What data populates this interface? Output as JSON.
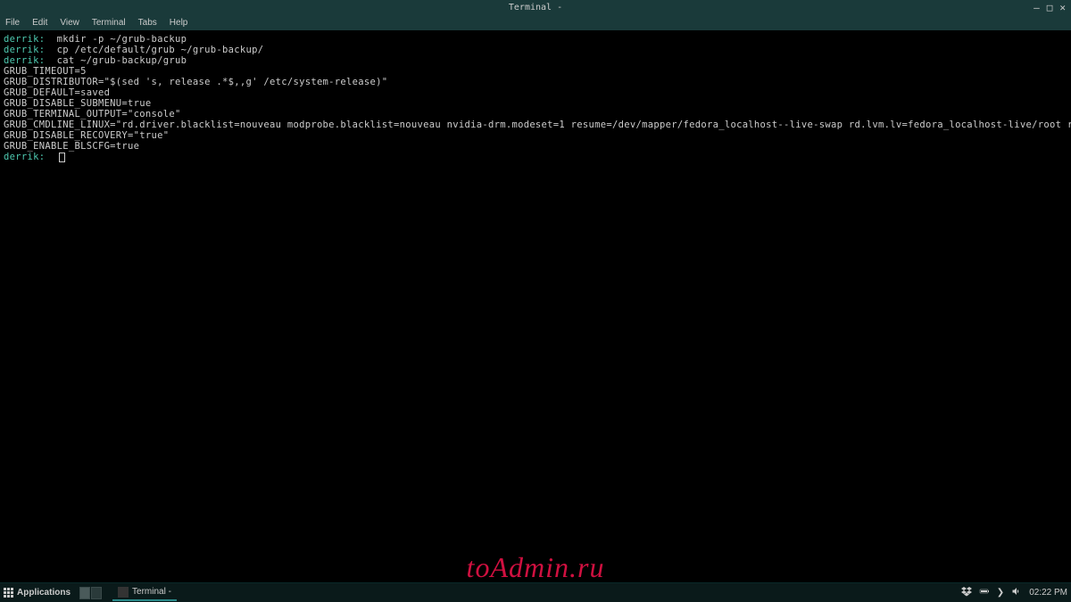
{
  "window": {
    "title": "Terminal -"
  },
  "menubar": {
    "items": [
      "File",
      "Edit",
      "View",
      "Terminal",
      "Tabs",
      "Help"
    ]
  },
  "terminal": {
    "lines": [
      {
        "prompt": "derrik:",
        "cmd": "  mkdir -p ~/grub-backup"
      },
      {
        "prompt": "derrik:",
        "cmd": "  cp /etc/default/grub ~/grub-backup/"
      },
      {
        "prompt": "derrik:",
        "cmd": "  cat ~/grub-backup/grub"
      },
      {
        "output": "GRUB_TIMEOUT=5"
      },
      {
        "output": "GRUB_DISTRIBUTOR=\"$(sed 's, release .*$,,g' /etc/system-release)\""
      },
      {
        "output": "GRUB_DEFAULT=saved"
      },
      {
        "output": "GRUB_DISABLE_SUBMENU=true"
      },
      {
        "output": "GRUB_TERMINAL_OUTPUT=\"console\""
      },
      {
        "output": "GRUB_CMDLINE_LINUX=\"rd.driver.blacklist=nouveau modprobe.blacklist=nouveau nvidia-drm.modeset=1 resume=/dev/mapper/fedora_localhost--live-swap rd.lvm.lv=fedora_localhost-live/root rd.lvm.lv=fedora_localhost-live/swap rhgb quiet\""
      },
      {
        "output": "GRUB_DISABLE_RECOVERY=\"true\""
      },
      {
        "output": "GRUB_ENABLE_BLSCFG=true"
      },
      {
        "prompt": "derrik:",
        "cmd": "  ",
        "cursor": true
      }
    ]
  },
  "taskbar": {
    "apps_label": "Applications",
    "task_label": "Terminal -",
    "clock": "02:22 PM"
  },
  "watermark": "toAdmin.ru"
}
